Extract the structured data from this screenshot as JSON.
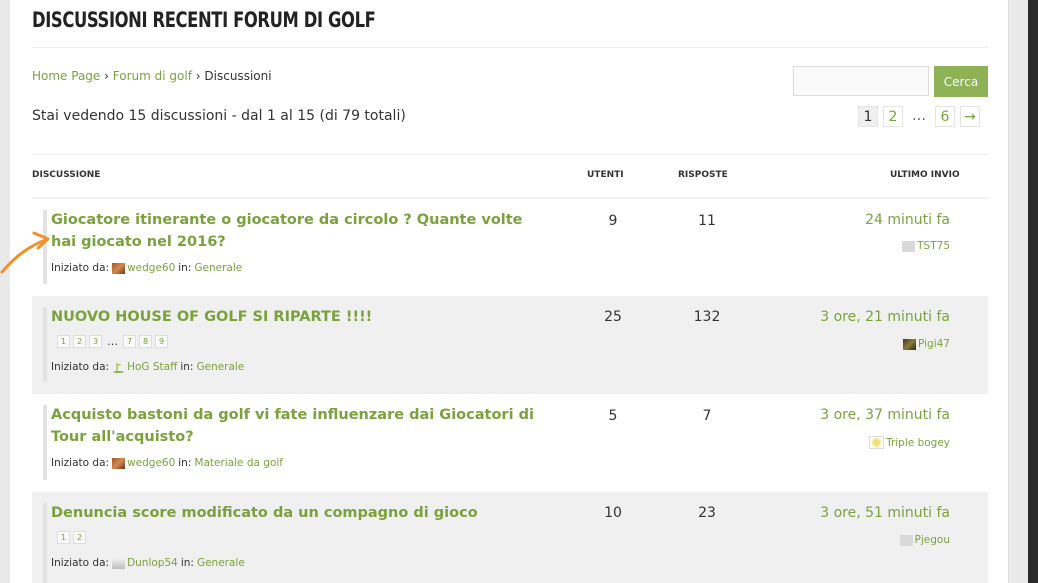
{
  "header": {
    "title": "DISCUSSIONI RECENTI FORUM DI GOLF"
  },
  "breadcrumb": {
    "home": "Home Page",
    "sep": "›",
    "forum": "Forum di golf",
    "current": "Discussioni"
  },
  "search": {
    "placeholder": "",
    "button": "Cerca"
  },
  "summary": {
    "count_text": "Stai vedendo 15 discussioni - dal 1 al 15 (di 79 totali)"
  },
  "pagination": {
    "pages": [
      "1",
      "2"
    ],
    "dots": "…",
    "last": "6",
    "next": "→"
  },
  "columns": {
    "topic": "DISCUSSIONE",
    "users": "UTENTI",
    "replies": "RISPOSTE",
    "last": "ULTIMO INVIO"
  },
  "labels": {
    "started_by": "Iniziato da:",
    "in": "in:"
  },
  "topics": [
    {
      "title": "Giocatore itinerante o giocatore da circolo ? Quante volte hai giocato nel 2016?",
      "pages": [],
      "author": "wedge60",
      "forum": "Generale",
      "users": "9",
      "replies": "11",
      "freshness": "24 minuti fa",
      "last_user": "TST75"
    },
    {
      "title": "NUOVO HOUSE OF GOLF SI RIPARTE !!!!",
      "pages": [
        "1",
        "2",
        "3",
        "…",
        "7",
        "8",
        "9"
      ],
      "author": "HoG Staff",
      "forum": "Generale",
      "users": "25",
      "replies": "132",
      "freshness": "3 ore, 21 minuti fa",
      "last_user": "Pigi47"
    },
    {
      "title": "Acquisto bastoni da golf vi fate influenzare dai Giocatori di Tour all'acquisto?",
      "pages": [],
      "author": "wedge60",
      "forum": "Materiale da golf",
      "users": "5",
      "replies": "7",
      "freshness": "3 ore, 37 minuti fa",
      "last_user": "Triple bogey"
    },
    {
      "title": "Denuncia score modificato da un compagno di gioco",
      "pages": [
        "1",
        "2"
      ],
      "author": "Dunlop54",
      "forum": "Generale",
      "users": "10",
      "replies": "23",
      "freshness": "3 ore, 51 minuti fa",
      "last_user": "Pjegou"
    }
  ]
}
